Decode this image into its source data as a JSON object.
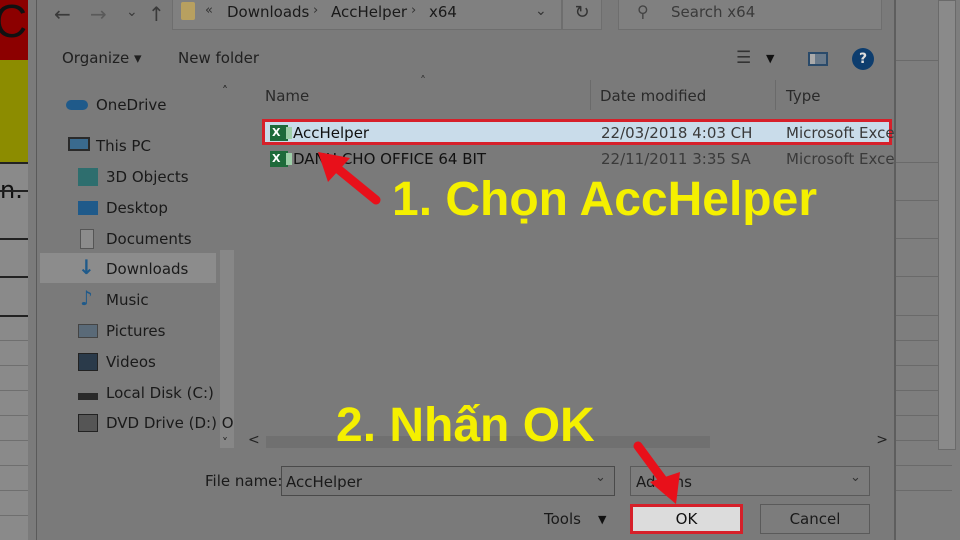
{
  "background": {
    "excel_cell_letter": "C",
    "excel_cell_text": "n."
  },
  "nav_buttons": {
    "back": "←",
    "forward": "→",
    "recent": "⌄",
    "up": "↑"
  },
  "address_bar": {
    "overflow": "«",
    "crumbs": [
      "Downloads",
      "AccHelper",
      "x64"
    ],
    "separator": "›",
    "dropdown": "⌄"
  },
  "refresh": "↻",
  "search": {
    "placeholder": "Search x64",
    "icon": "⚲"
  },
  "toolbar": {
    "organize": "Organize ▾",
    "new_folder": "New folder",
    "help": "?",
    "view_icon": "☰",
    "view_caret": "▼"
  },
  "nav_pane": {
    "items": [
      {
        "label": "OneDrive",
        "icon": "cloud-icon"
      },
      {
        "label": "This PC",
        "icon": "computer-icon"
      },
      {
        "label": "3D Objects",
        "icon": "cube-icon"
      },
      {
        "label": "Desktop",
        "icon": "desktop-icon"
      },
      {
        "label": "Documents",
        "icon": "document-icon"
      },
      {
        "label": "Downloads",
        "icon": "download-icon",
        "selected": true
      },
      {
        "label": "Music",
        "icon": "music-icon"
      },
      {
        "label": "Pictures",
        "icon": "picture-icon"
      },
      {
        "label": "Videos",
        "icon": "video-icon"
      },
      {
        "label": "Local Disk (C:)",
        "icon": "disk-icon"
      },
      {
        "label": "DVD Drive (D:) O",
        "icon": "dvd-icon"
      }
    ],
    "scroll_up": "˄",
    "scroll_down": "˅"
  },
  "file_list": {
    "columns": [
      "Name",
      "Date modified",
      "Type"
    ],
    "sort_indicator": "˄",
    "rows": [
      {
        "name": "AccHelper",
        "date": "22/03/2018 4:03 CH",
        "type": "Microsoft Excel",
        "selected": true
      },
      {
        "name": "DANH CHO OFFICE 64 BIT",
        "date": "22/11/2011 3:35 SA",
        "type": "Microsoft Excel",
        "selected": false
      }
    ],
    "hscroll_left": "<",
    "hscroll_right": ">"
  },
  "bottom": {
    "file_name_label": "File name:",
    "file_name_value": "AccHelper",
    "file_type_value": "Add-ins",
    "tools_label": "Tools",
    "tools_caret": "▼",
    "ok_label": "OK",
    "cancel_label": "Cancel",
    "caret": "⌄"
  },
  "annotations": {
    "step1": "1. Chọn AccHelper",
    "step2": "2. Nhấn OK",
    "highlight_color": "#d6202a",
    "text_color": "#f5f000"
  }
}
